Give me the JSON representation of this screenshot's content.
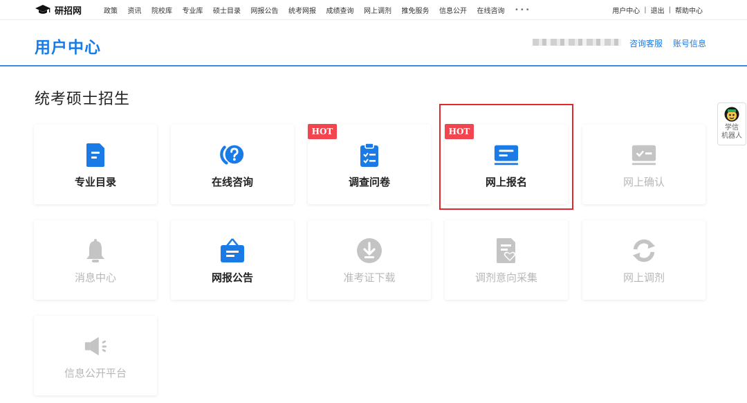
{
  "site": {
    "logo_text": "研招网"
  },
  "nav": [
    {
      "label": "政策"
    },
    {
      "label": "资讯"
    },
    {
      "label": "院校库"
    },
    {
      "label": "专业库"
    },
    {
      "label": "硕士目录"
    },
    {
      "label": "网报公告"
    },
    {
      "label": "统考网报"
    },
    {
      "label": "成绩查询"
    },
    {
      "label": "网上调剂"
    },
    {
      "label": "推免服务"
    },
    {
      "label": "信息公开"
    },
    {
      "label": "在线咨询"
    }
  ],
  "nav_more": "•••",
  "topright": {
    "user_center": "用户中心",
    "sep": "|",
    "logout": "退出",
    "help": "帮助中心"
  },
  "header": {
    "title": "用户中心",
    "consult_link": "咨询客服",
    "account_link": "账号信息"
  },
  "section": {
    "title": "统考硕士招生"
  },
  "badge": {
    "hot": "HOT"
  },
  "cards": [
    {
      "label": "专业目录"
    },
    {
      "label": "在线咨询"
    },
    {
      "label": "调查问卷"
    },
    {
      "label": "网上报名"
    },
    {
      "label": "网上确认"
    },
    {
      "label": "消息中心"
    },
    {
      "label": "网报公告"
    },
    {
      "label": "准考证下载"
    },
    {
      "label": "调剂意向采集"
    },
    {
      "label": "网上调剂"
    },
    {
      "label": "信息公开平台"
    }
  ],
  "robot": {
    "line1": "学信",
    "line2": "机器人"
  },
  "colors": {
    "accent": "#1b7be6",
    "hot": "#f2454f",
    "highlight": "#e0262e",
    "disabled": "#c4c4c4"
  }
}
